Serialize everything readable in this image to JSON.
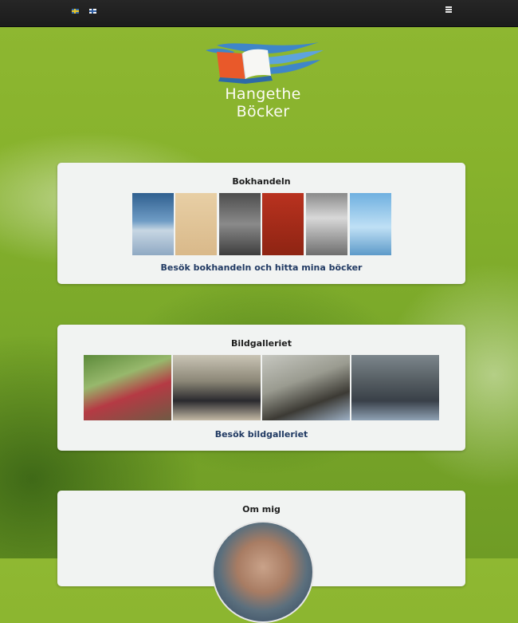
{
  "header": {
    "flags": [
      {
        "name": "swedish-flag-icon",
        "color": "#3a6fa8"
      },
      {
        "name": "finnish-flag-icon",
        "color": "#2d5ca0"
      }
    ],
    "menu_icon": "hamburger-menu-icon"
  },
  "logo": {
    "text": "Hangethe Böcker",
    "icon": "open-book-waves-logo"
  },
  "sections": {
    "bookshop": {
      "title": "Bokhandeln",
      "link": "Besök bokhandeln och hitta mina böcker",
      "books": [
        "book-cover-1",
        "book-cover-2",
        "book-cover-3",
        "book-cover-4",
        "book-cover-5",
        "book-cover-6"
      ]
    },
    "gallery": {
      "title": "Bildgalleriet",
      "link": "Besök bildgalleriet",
      "photos": [
        "gallery-photo-1",
        "gallery-photo-2",
        "gallery-photo-3",
        "gallery-photo-4"
      ]
    },
    "about": {
      "title": "Om mig"
    }
  },
  "colors": {
    "background_green": "#87b22c",
    "topbar": "#1b1b1b",
    "link": "#213a63",
    "card": "#f1f3f2"
  }
}
